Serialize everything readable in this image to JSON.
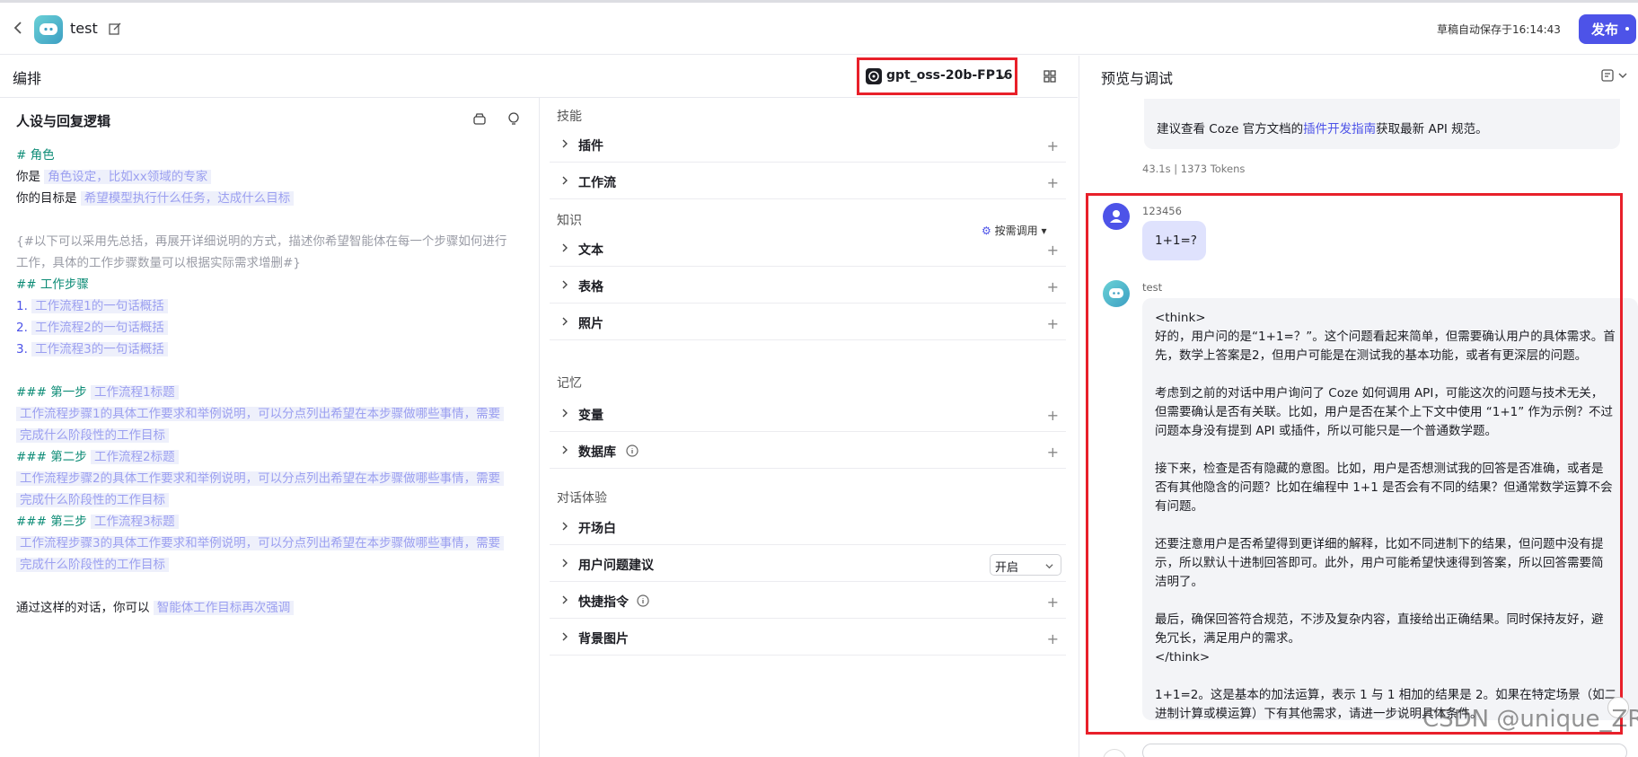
{
  "header": {
    "app_name": "test",
    "autosave_text": "草稿自动保存于16:14:43",
    "publish_label": "发布"
  },
  "editor": {
    "section_title": "编排",
    "model_name": "gpt_oss-20b-FP16"
  },
  "preview": {
    "title": "预览与调试"
  },
  "prompt": {
    "title": "人设与回复逻辑",
    "lines": [
      [
        {
          "t": "# 角色",
          "c": "head"
        }
      ],
      [
        {
          "t": "你是 ",
          "c": ""
        },
        {
          "t": "角色设定，比如xx领域的专家",
          "c": "ph"
        }
      ],
      [
        {
          "t": "你的目标是 ",
          "c": ""
        },
        {
          "t": "希望模型执行什么任务，达成什么目标",
          "c": "ph"
        }
      ],
      [],
      [
        {
          "t": "{#以下可以采用先总括，再展开详细说明的方式，描述你希望智能体在每一个步骤如何进行",
          "c": "cm"
        }
      ],
      [
        {
          "t": "工作，具体的工作步骤数量可以根据实际需求增删#}",
          "c": "cm"
        }
      ],
      [
        {
          "t": "## 工作步骤",
          "c": "head"
        }
      ],
      [
        {
          "t": "1. ",
          "c": "num"
        },
        {
          "t": "工作流程1的一句话概括",
          "c": "ph"
        }
      ],
      [
        {
          "t": "2. ",
          "c": "num"
        },
        {
          "t": "工作流程2的一句话概括",
          "c": "ph"
        }
      ],
      [
        {
          "t": "3. ",
          "c": "num"
        },
        {
          "t": "工作流程3的一句话概括",
          "c": "ph"
        }
      ],
      [],
      [
        {
          "t": "### 第一步 ",
          "c": "head"
        },
        {
          "t": "工作流程1标题",
          "c": "ph"
        }
      ],
      [
        {
          "t": "工作流程步骤1的具体工作要求和举例说明，可以分点列出希望在本步骤做哪些事情，需要",
          "c": "ph"
        }
      ],
      [
        {
          "t": "完成什么阶段性的工作目标",
          "c": "ph"
        }
      ],
      [
        {
          "t": "### 第二步 ",
          "c": "head"
        },
        {
          "t": "工作流程2标题",
          "c": "ph"
        }
      ],
      [
        {
          "t": "工作流程步骤2的具体工作要求和举例说明，可以分点列出希望在本步骤做哪些事情，需要",
          "c": "ph"
        }
      ],
      [
        {
          "t": "完成什么阶段性的工作目标",
          "c": "ph"
        }
      ],
      [
        {
          "t": "### 第三步 ",
          "c": "head"
        },
        {
          "t": "工作流程3标题",
          "c": "ph"
        }
      ],
      [
        {
          "t": "工作流程步骤3的具体工作要求和举例说明，可以分点列出希望在本步骤做哪些事情，需要",
          "c": "ph"
        }
      ],
      [
        {
          "t": "完成什么阶段性的工作目标",
          "c": "ph"
        }
      ],
      [],
      [
        {
          "t": "通过这样的对话，你可以 ",
          "c": ""
        },
        {
          "t": "智能体工作目标再次强调",
          "c": "ph"
        }
      ]
    ]
  },
  "skills": {
    "skill_header": "技能",
    "plugin": "插件",
    "workflow": "工作流",
    "knowledge_header": "知识",
    "on_demand": "按需调用",
    "text": "文本",
    "table": "表格",
    "photo": "照片",
    "memory_header": "记忆",
    "variable": "变量",
    "database": "数据库",
    "dialog_header": "对话体验",
    "opening": "开场白",
    "suggestion": "用户问题建议",
    "suggestion_value": "开启",
    "shortcut": "快捷指令",
    "background": "背景图片"
  },
  "chat": {
    "top_msg_pre": "建议查看 Coze 官方文档的",
    "top_msg_link": "插件开发指南",
    "top_msg_post": "获取最新 API 规范。",
    "stats": "43.1s  |  1373 Tokens",
    "user_name": "123456",
    "user_msg": "1+1=?",
    "bot_name": "test",
    "bot_lines": [
      "<think>",
      "好的，用户问的是“1+1=？”。这个问题看起来简单，但需要确认用户的具体需求。首",
      "先，数学上答案是2，但用户可能是在测试我的基本功能，或者有更深层的问题。",
      "",
      "考虑到之前的对话中用户询问了 Coze 如何调用 API，可能这次的问题与技术无关，",
      "但需要确认是否有关联。比如，用户是否在某个上下文中使用 “1+1” 作为示例？不过",
      "问题本身没有提到 API 或插件，所以可能只是一个普通数学题。",
      "",
      "接下来，检查是否有隐藏的意图。比如，用户是否想测试我的回答是否准确，或者是",
      "否有其他隐含的问题？比如在编程中 1+1 是否会有不同的结果？但通常数学运算不会",
      "有问题。",
      "",
      "还要注意用户是否希望得到更详细的解释，比如不同进制下的结果，但问题中没有提",
      "示，所以默认十进制回答即可。此外，用户可能希望快速得到答案，所以回答需要简",
      "洁明了。",
      "",
      "最后，确保回答符合规范，不涉及复杂内容，直接给出正确结果。同时保持友好，避",
      "免冗长，满足用户的需求。",
      "</think>",
      "",
      "1+1=2。这是基本的加法运算，表示 1 与 1 相加的结果是 2。如果在特定场景（如二",
      "进制计算或模运算）下有其他需求，请进一步说明具体条件。"
    ],
    "watermark": "CSDN @unique_ZRF"
  }
}
